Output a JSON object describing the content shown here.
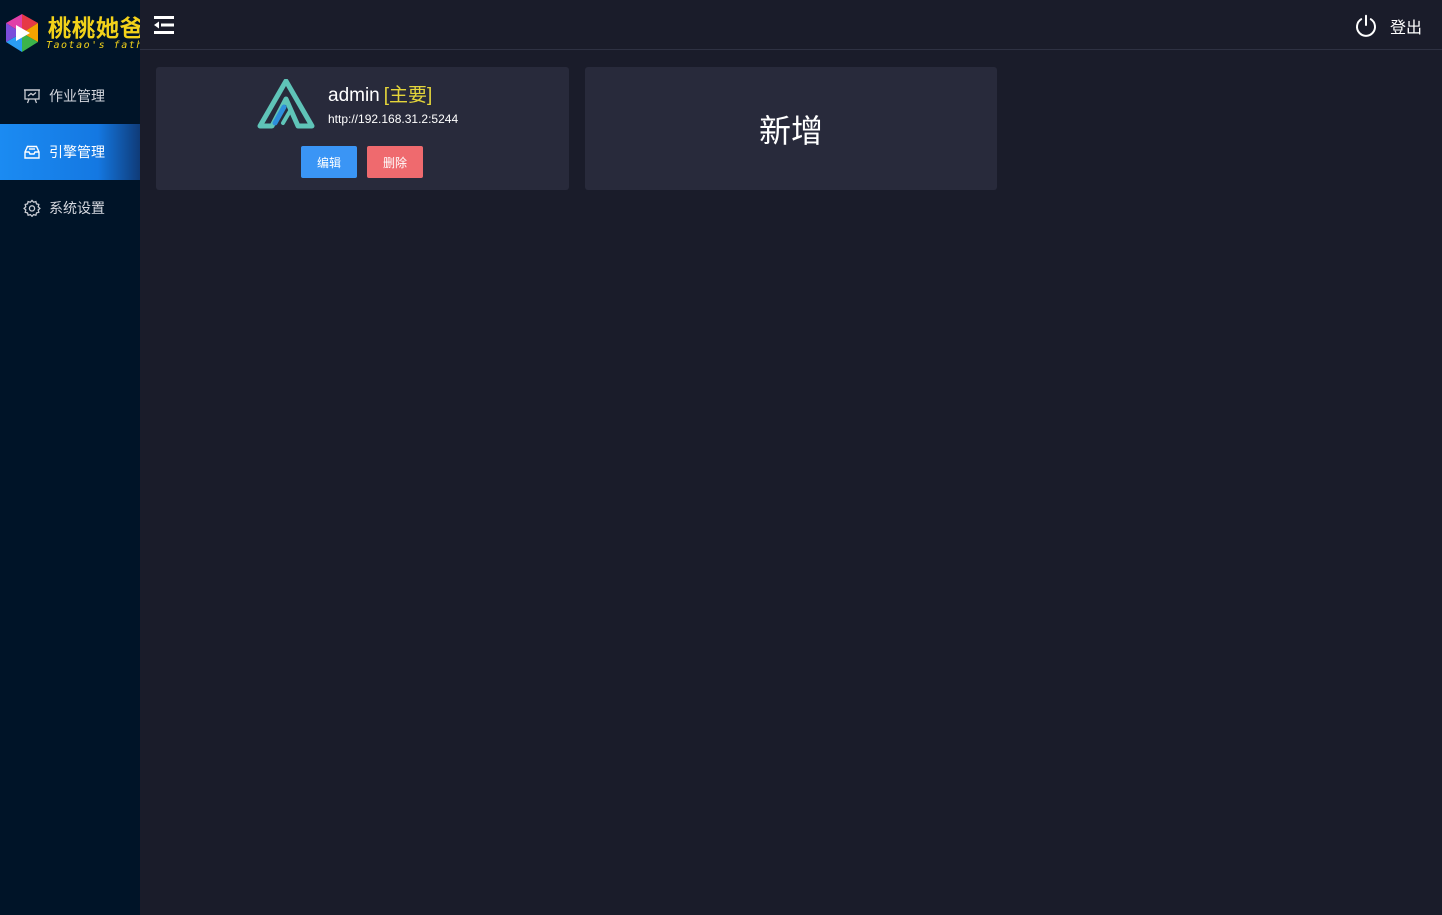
{
  "logo": {
    "title_cn": "桃桃她爸",
    "title_en": "Taotao's father",
    "color": "#f2d21a"
  },
  "sidebar": {
    "items": [
      {
        "label": "作业管理",
        "icon": "presentation-board-icon",
        "active": false
      },
      {
        "label": "引擎管理",
        "icon": "inbox-tray-icon",
        "active": true
      },
      {
        "label": "系统设置",
        "icon": "gear-icon",
        "active": false
      }
    ]
  },
  "header": {
    "collapse_icon": "menu-collapse-icon",
    "logout_label": "登出",
    "logout_icon": "power-icon"
  },
  "engines": [
    {
      "name": "admin",
      "tag": "[主要]",
      "url": "http://192.168.31.2:5244",
      "edit_label": "编辑",
      "delete_label": "删除",
      "logo_icon": "alist-logo-icon"
    }
  ],
  "add_card": {
    "label": "新增"
  },
  "colors": {
    "background": "#1a1c2a",
    "sidebar": "#001428",
    "card": "#282a3b",
    "active_menu": "#1b8bf2",
    "tag": "#e4d53a",
    "edit_button": "#3a95f5",
    "delete_button": "#ef6a6e"
  }
}
